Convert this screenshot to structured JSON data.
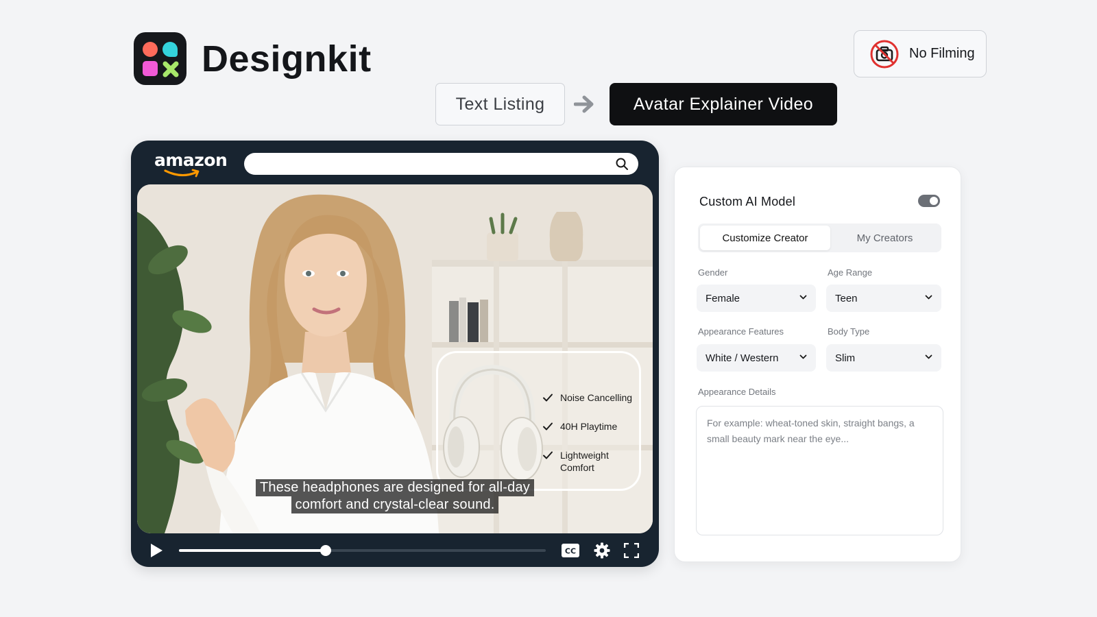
{
  "brand": {
    "name": "Designkit"
  },
  "badge": {
    "label": "No Filming",
    "icon": "no-camera-icon"
  },
  "flow": {
    "from_label": "Text Listing",
    "to_label": "Avatar Explainer Video",
    "arrow_icon": "arrow-right-icon"
  },
  "video": {
    "store_logo_text": "amazon",
    "search": {
      "value": "",
      "placeholder": ""
    },
    "features": [
      {
        "lines": [
          "Noise Cancelling"
        ]
      },
      {
        "lines": [
          "40H Playtime"
        ]
      },
      {
        "lines": [
          "Lightweight",
          "Comfort"
        ]
      }
    ],
    "caption": {
      "line1": "These headphones are designed for all-day",
      "line2": "comfort and crystal-clear sound."
    },
    "progress": 0.4,
    "controls": {
      "cc_label": "CC"
    }
  },
  "panel": {
    "title": "Custom AI Model",
    "toggle_on": true,
    "tabs": [
      {
        "label": "Customize Creator",
        "active": true
      },
      {
        "label": "My Creators",
        "active": false
      }
    ],
    "fields": {
      "gender": {
        "label": "Gender",
        "value": "Female"
      },
      "age_range": {
        "label": "Age Range",
        "value": "Teen"
      },
      "appearance_features": {
        "label": "Appearance Features",
        "value": "White / Western"
      },
      "body_type": {
        "label": "Body Type",
        "value": "Slim"
      },
      "appearance_details": {
        "label": "Appearance Details",
        "value": "",
        "placeholder": "For example: wheat-toned skin, straight bangs, a small beauty mark near the eye..."
      }
    }
  },
  "colors": {
    "background": "#f3f4f6",
    "primary_dark": "#0f1012",
    "player_frame": "#182430",
    "amazon_orange": "#ff9900",
    "no_filming_red": "#e0312f"
  }
}
